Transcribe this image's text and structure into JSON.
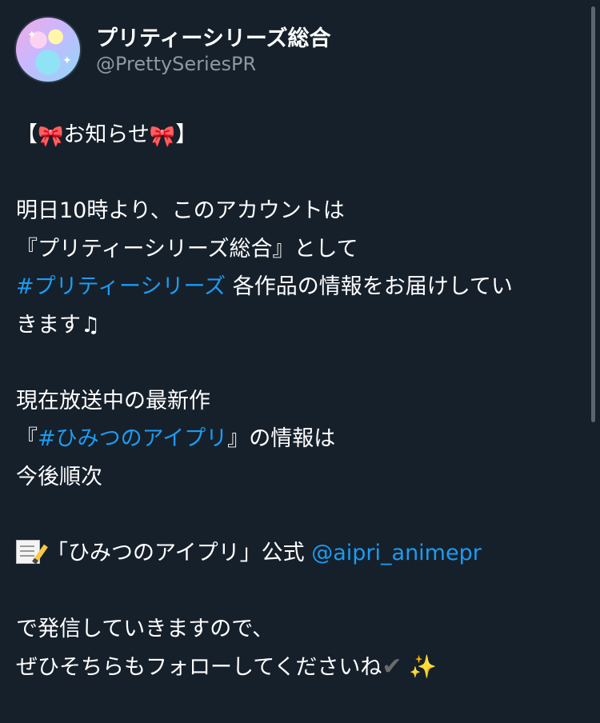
{
  "account": {
    "display_name": "プリティーシリーズ総合",
    "handle": "@PrettySeriesPR"
  },
  "tweet": {
    "line1_pre": "【",
    "line1_icon1": "ribbon-emoji",
    "line1_mid": "お知らせ",
    "line1_icon2": "ribbon-emoji",
    "line1_post": "】",
    "line2": "明日10時より、このアカウントは",
    "line3": "『プリティーシリーズ総合』として",
    "line4_hashtag": "#プリティーシリーズ",
    "line4_text": " 各作品の情報をお届けしてい",
    "line5": "きます♫",
    "line6": "現在放送中の最新作",
    "line7_pre": "『",
    "line7_hashtag": "#ひみつのアイプリ",
    "line7_post": "』の情報は",
    "line8": "今後順次",
    "line9_icon": "memo-emoji",
    "line9_text": "「ひみつのアイプリ」公式 ",
    "line9_mention": "@aipri_animepr",
    "line10": "で発信していきますので、",
    "line11_text": "ぜひそちらもフォローしてくださいね",
    "line11_check": "✔",
    "line11_sparkles": "✨"
  },
  "colors": {
    "background": "#16202b",
    "link": "#1d9bf0",
    "handle": "#8b98a5"
  }
}
